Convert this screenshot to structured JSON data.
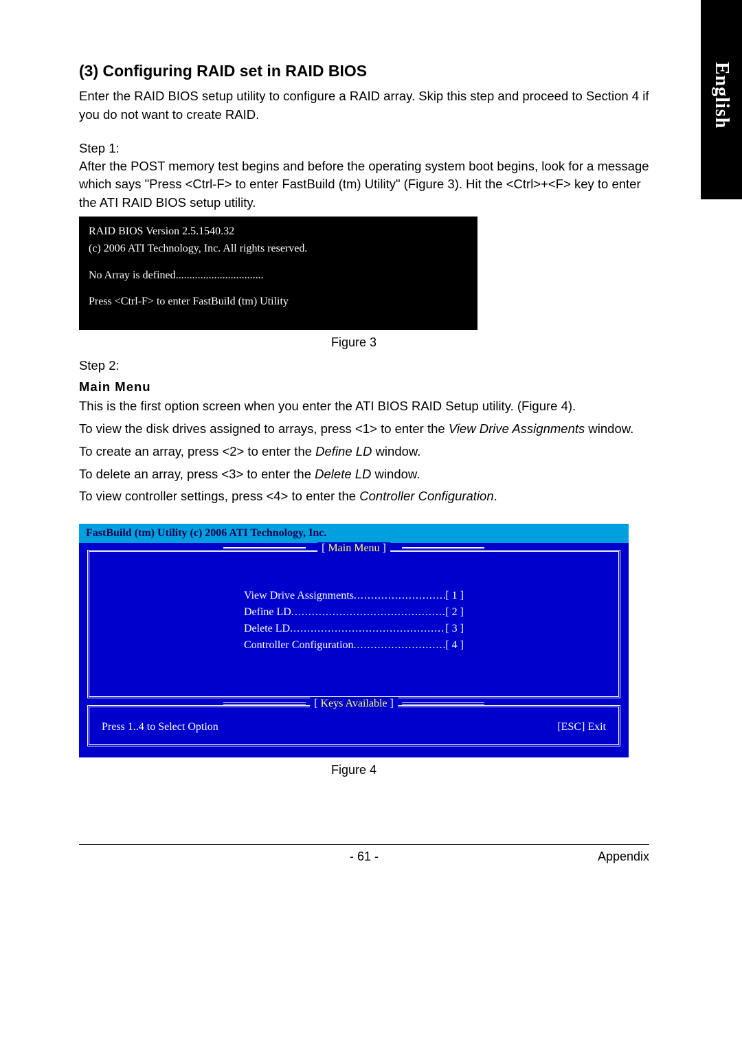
{
  "sideTab": "English",
  "sectionTitle": "(3) Configuring RAID set in RAID BIOS",
  "intro": "Enter the RAID BIOS setup utility to configure a RAID array. Skip this step and proceed to Section 4 if you do not want to create RAID.",
  "step1Label": "Step 1:",
  "step1Text": "After the POST memory test begins and before the operating system boot begins, look for a message which says \"Press <Ctrl-F> to enter FastBuild (tm) Utility\" (Figure 3). Hit the <Ctrl>+<F> key to enter the ATI RAID BIOS setup utility.",
  "fig3": {
    "line1": "RAID BIOS Version 2.5.1540.32",
    "line2": "(c) 2006 ATI Technology, Inc. All rights reserved.",
    "line3": "No Array is defined................................",
    "line4": "Press <Ctrl-F> to enter FastBuild (tm) Utility"
  },
  "fig3Caption": "Figure 3",
  "step2Label": "Step 2:",
  "mainMenuHead": "Main Menu",
  "mm_line1_a": "This is the first option screen when you enter the ATI BIOS RAID Setup utility. (Figure 4).",
  "mm_line2_a": "To view the disk drives assigned to arrays, press <1> to enter the ",
  "mm_line2_i": "View Drive Assignments",
  "mm_line2_b": " window.",
  "mm_line3_a": "To create an array, press <2> to enter the ",
  "mm_line3_i": "Define LD",
  "mm_line3_b": " window.",
  "mm_line4_a": "To delete an array, press <3> to enter the ",
  "mm_line4_i": "Delete LD",
  "mm_line4_b": " window.",
  "mm_line5_a": "To view controller settings, press <4> to enter the ",
  "mm_line5_i": "Controller Configuration",
  "mm_line5_b": ".",
  "fig4": {
    "header": "FastBuild (tm) Utility (c) 2006 ATI Technology, Inc.",
    "mainMenuLabel": "Main Menu",
    "items": [
      {
        "label": "View Drive Assignments",
        "key": "[ 1 ]"
      },
      {
        "label": "Define LD",
        "key": "[ 2 ]"
      },
      {
        "label": "Delete LD",
        "key": "[ 3 ]"
      },
      {
        "label": "Controller Configuration",
        "key": "[ 4 ]"
      }
    ],
    "keysLabel": "Keys Available",
    "keysLeft": "Press 1..4 to Select Option",
    "keysRight": "[ESC] Exit"
  },
  "fig4Caption": "Figure 4",
  "footer": {
    "page": "- 61 -",
    "section": "Appendix"
  }
}
